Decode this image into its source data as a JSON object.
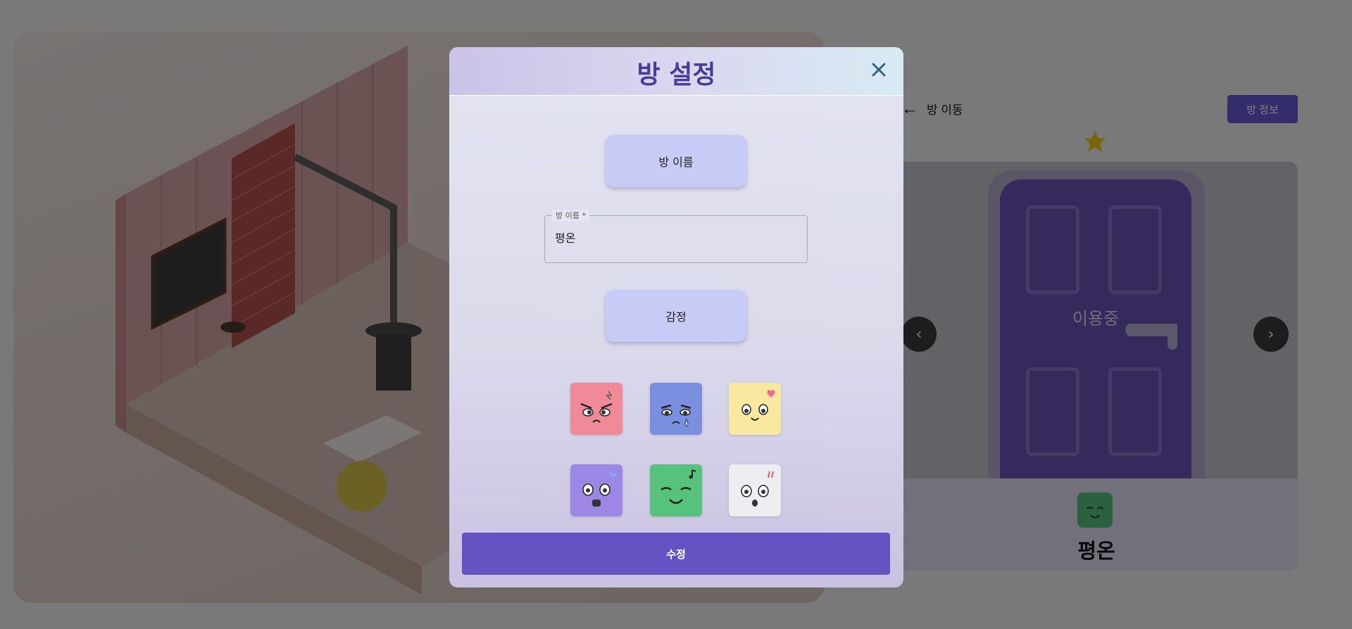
{
  "background": {
    "move_room_label": "방 이동",
    "room_info_label": "방 정보",
    "door_status": "이용중",
    "current_emotion_name": "평온"
  },
  "modal": {
    "title": "방 설정",
    "room_name_section_label": "방 이름",
    "room_name_field": {
      "legend": "방 이름 *",
      "value": "평온"
    },
    "emotion_section_label": "감정",
    "emotions": [
      {
        "color": "#f08a98",
        "icon": "angry-face-icon"
      },
      {
        "color": "#7b8fe0",
        "icon": "sad-crying-face-icon"
      },
      {
        "color": "#fbe8a0",
        "icon": "love-face-icon"
      },
      {
        "color": "#9d87e6",
        "icon": "surprised-face-icon"
      },
      {
        "color": "#57c27c",
        "icon": "calm-face-icon"
      },
      {
        "color": "#eeeef2",
        "icon": "shocked-face-icon"
      }
    ],
    "submit_label": "수정"
  },
  "colors": {
    "accent": "#6553c4",
    "title": "#4a3a9a",
    "section_button": "#c7cbf5"
  }
}
